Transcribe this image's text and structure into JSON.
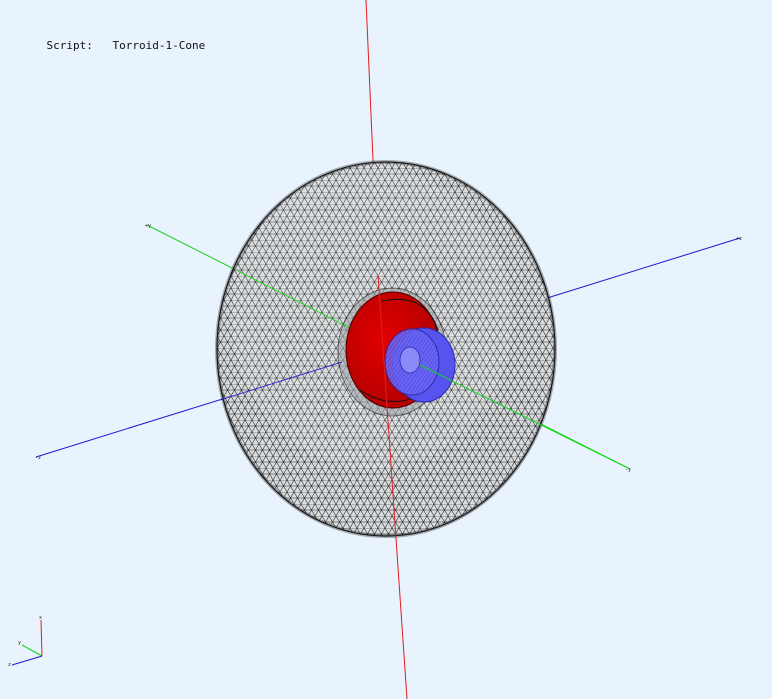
{
  "viewer": {
    "script_label": "Script:",
    "script_name": "Torroid-1-Cone"
  },
  "colors": {
    "background": "#e8f3fd",
    "axis_x": "#e51d1d",
    "axis_y": "#19d319",
    "axis_z": "#1a1ad0",
    "torus_mesh": "#111111",
    "torus_fill": "#d7dadd",
    "cone_red": "#d10000",
    "cone_blue": "#5a57f0"
  },
  "scene": {
    "objects": [
      "torus-mesh",
      "red-cone",
      "blue-cone"
    ]
  },
  "orientation_gizmo": {
    "axes": [
      "x",
      "y",
      "z"
    ]
  }
}
